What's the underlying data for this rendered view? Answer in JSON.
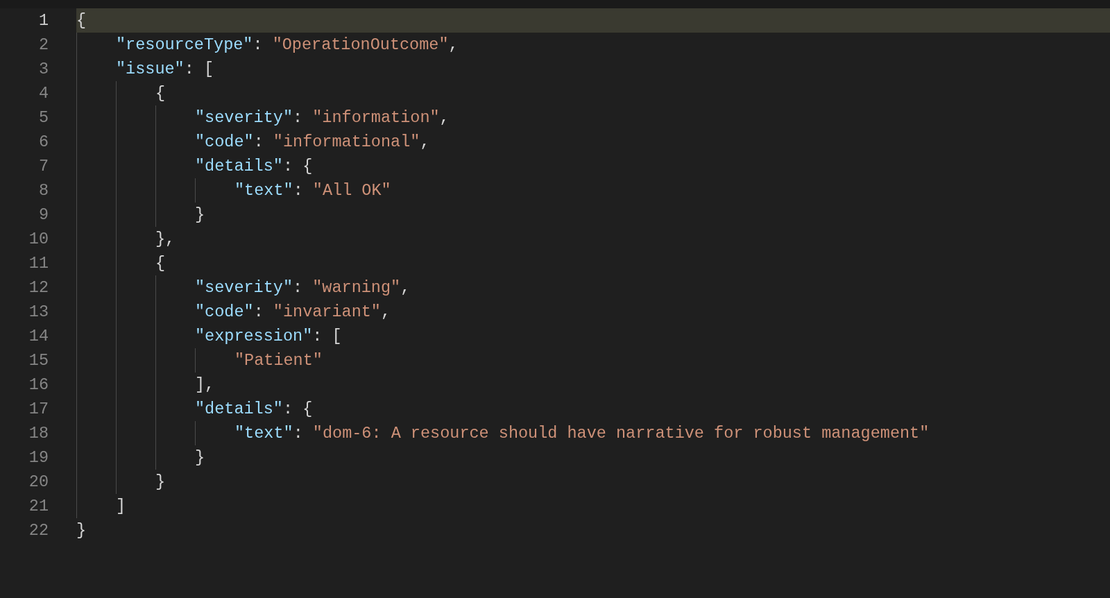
{
  "editor": {
    "lines": [
      {
        "number": "1",
        "current": true,
        "tokens": [
          {
            "kind": "punct",
            "text": "{"
          }
        ],
        "children": [
          {
            "number": "2",
            "current": false,
            "tokens": [
              {
                "kind": "key",
                "text": "\"resourceType\""
              },
              {
                "kind": "punct",
                "text": ": "
              },
              {
                "kind": "string",
                "text": "\"OperationOutcome\""
              },
              {
                "kind": "punct",
                "text": ","
              }
            ]
          },
          {
            "number": "3",
            "current": false,
            "tokens": [
              {
                "kind": "key",
                "text": "\"issue\""
              },
              {
                "kind": "punct",
                "text": ": ["
              }
            ],
            "children": [
              {
                "number": "4",
                "current": false,
                "tokens": [
                  {
                    "kind": "punct",
                    "text": "{"
                  }
                ],
                "children": [
                  {
                    "number": "5",
                    "current": false,
                    "tokens": [
                      {
                        "kind": "key",
                        "text": "\"severity\""
                      },
                      {
                        "kind": "punct",
                        "text": ": "
                      },
                      {
                        "kind": "string",
                        "text": "\"information\""
                      },
                      {
                        "kind": "punct",
                        "text": ","
                      }
                    ]
                  },
                  {
                    "number": "6",
                    "current": false,
                    "tokens": [
                      {
                        "kind": "key",
                        "text": "\"code\""
                      },
                      {
                        "kind": "punct",
                        "text": ": "
                      },
                      {
                        "kind": "string",
                        "text": "\"informational\""
                      },
                      {
                        "kind": "punct",
                        "text": ","
                      }
                    ]
                  },
                  {
                    "number": "7",
                    "current": false,
                    "tokens": [
                      {
                        "kind": "key",
                        "text": "\"details\""
                      },
                      {
                        "kind": "punct",
                        "text": ": {"
                      }
                    ],
                    "children": [
                      {
                        "number": "8",
                        "current": false,
                        "tokens": [
                          {
                            "kind": "key",
                            "text": "\"text\""
                          },
                          {
                            "kind": "punct",
                            "text": ": "
                          },
                          {
                            "kind": "string",
                            "text": "\"All OK\""
                          }
                        ]
                      }
                    ]
                  },
                  {
                    "number": "9",
                    "current": false,
                    "tokens": [
                      {
                        "kind": "punct",
                        "text": "}"
                      }
                    ]
                  }
                ]
              },
              {
                "number": "10",
                "current": false,
                "tokens": [
                  {
                    "kind": "punct",
                    "text": "},"
                  }
                ]
              },
              {
                "number": "11",
                "current": false,
                "tokens": [
                  {
                    "kind": "punct",
                    "text": "{"
                  }
                ],
                "children": [
                  {
                    "number": "12",
                    "current": false,
                    "tokens": [
                      {
                        "kind": "key",
                        "text": "\"severity\""
                      },
                      {
                        "kind": "punct",
                        "text": ": "
                      },
                      {
                        "kind": "string",
                        "text": "\"warning\""
                      },
                      {
                        "kind": "punct",
                        "text": ","
                      }
                    ]
                  },
                  {
                    "number": "13",
                    "current": false,
                    "tokens": [
                      {
                        "kind": "key",
                        "text": "\"code\""
                      },
                      {
                        "kind": "punct",
                        "text": ": "
                      },
                      {
                        "kind": "string",
                        "text": "\"invariant\""
                      },
                      {
                        "kind": "punct",
                        "text": ","
                      }
                    ]
                  },
                  {
                    "number": "14",
                    "current": false,
                    "tokens": [
                      {
                        "kind": "key",
                        "text": "\"expression\""
                      },
                      {
                        "kind": "punct",
                        "text": ": ["
                      }
                    ],
                    "children": [
                      {
                        "number": "15",
                        "current": false,
                        "tokens": [
                          {
                            "kind": "string",
                            "text": "\"Patient\""
                          }
                        ]
                      }
                    ]
                  },
                  {
                    "number": "16",
                    "current": false,
                    "tokens": [
                      {
                        "kind": "punct",
                        "text": "],"
                      }
                    ]
                  },
                  {
                    "number": "17",
                    "current": false,
                    "tokens": [
                      {
                        "kind": "key",
                        "text": "\"details\""
                      },
                      {
                        "kind": "punct",
                        "text": ": {"
                      }
                    ],
                    "children": [
                      {
                        "number": "18",
                        "current": false,
                        "tokens": [
                          {
                            "kind": "key",
                            "text": "\"text\""
                          },
                          {
                            "kind": "punct",
                            "text": ": "
                          },
                          {
                            "kind": "string",
                            "text": "\"dom-6: A resource should have narrative for robust management\""
                          }
                        ]
                      }
                    ]
                  },
                  {
                    "number": "19",
                    "current": false,
                    "tokens": [
                      {
                        "kind": "punct",
                        "text": "}"
                      }
                    ]
                  }
                ]
              },
              {
                "number": "20",
                "current": false,
                "tokens": [
                  {
                    "kind": "punct",
                    "text": "}"
                  }
                ]
              }
            ]
          },
          {
            "number": "21",
            "current": false,
            "tokens": [
              {
                "kind": "punct",
                "text": "]"
              }
            ]
          }
        ]
      },
      {
        "number": "22",
        "current": false,
        "tokens": [
          {
            "kind": "punct",
            "text": "}"
          }
        ]
      }
    ]
  }
}
